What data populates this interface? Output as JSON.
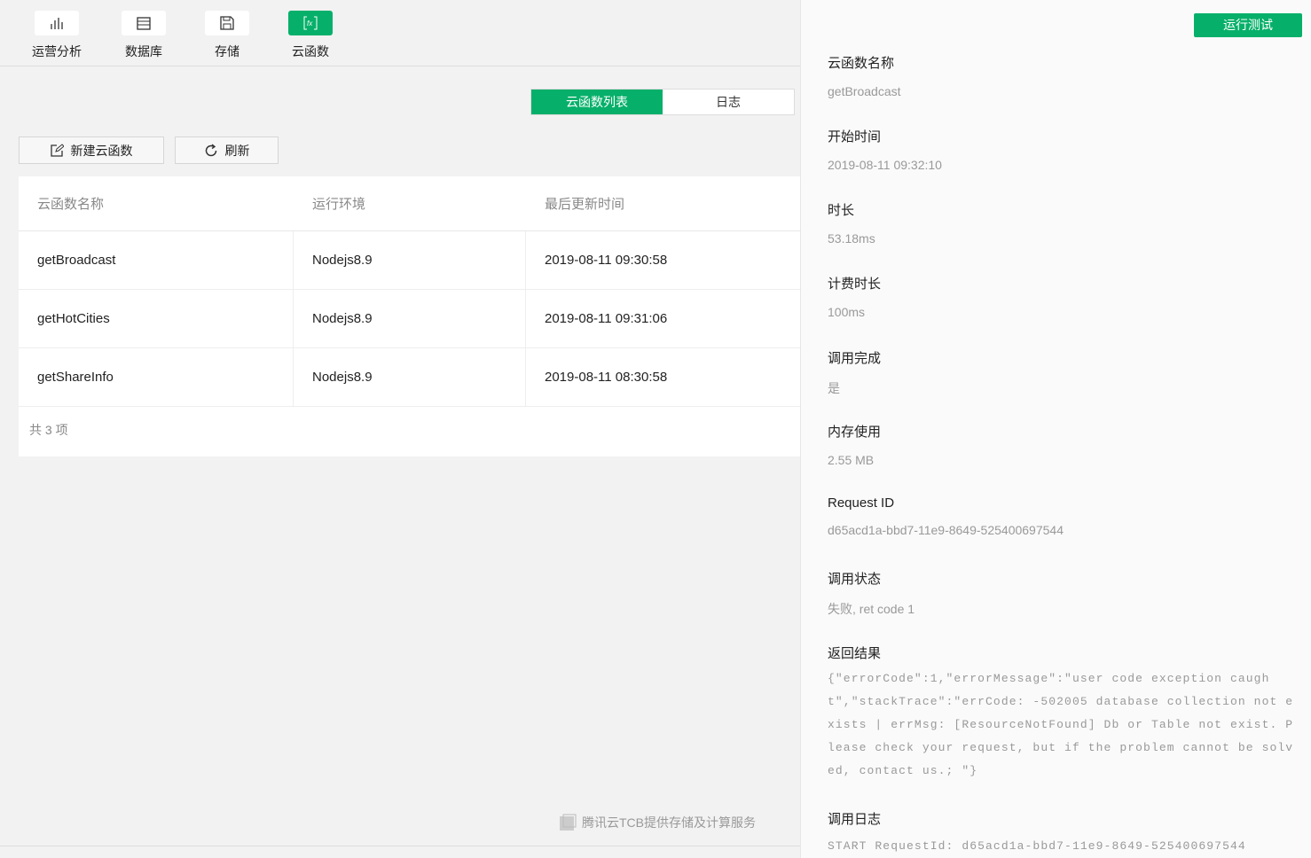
{
  "nav": [
    {
      "label": "运营分析",
      "icon": "bar-chart-icon"
    },
    {
      "label": "数据库",
      "icon": "database-icon"
    },
    {
      "label": "存储",
      "icon": "save-icon"
    },
    {
      "label": "云函数",
      "icon": "function-icon"
    }
  ],
  "tabs": [
    "云函数列表",
    "日志"
  ],
  "toolbar": {
    "new": "新建云函数",
    "refresh": "刷新"
  },
  "table": {
    "headers": [
      "云函数名称",
      "运行环境",
      "最后更新时间"
    ],
    "rows": [
      [
        "getBroadcast",
        "Nodejs8.9",
        "2019-08-11 09:30:58"
      ],
      [
        "getHotCities",
        "Nodejs8.9",
        "2019-08-11 09:31:06"
      ],
      [
        "getShareInfo",
        "Nodejs8.9",
        "2019-08-11 08:30:58"
      ]
    ],
    "total": "共 3 项"
  },
  "footer": "腾讯云TCB提供存储及计算服务",
  "panel": {
    "run_button": "运行测试",
    "fields": [
      {
        "label": "云函数名称",
        "value": "getBroadcast"
      },
      {
        "label": "开始时间",
        "value": "2019-08-11 09:32:10"
      },
      {
        "label": "时长",
        "value": "53.18ms"
      },
      {
        "label": "计费时长",
        "value": "100ms"
      },
      {
        "label": "调用完成",
        "value": "是"
      },
      {
        "label": "内存使用",
        "value": "2.55 MB"
      },
      {
        "label": "Request ID",
        "value": "d65acd1a-bbd7-11e9-8649-525400697544"
      },
      {
        "label": "调用状态",
        "value": "失败, ret code 1"
      }
    ],
    "result_label": "返回结果",
    "result": "{\"errorCode\":1,\"errorMessage\":\"user code exception caught\",\"stackTrace\":\"errCode: -502005 database collection not exists | errMsg: [ResourceNotFound] Db or Table not exist. Please check your request, but if the problem cannot be solved, contact us.; \"}",
    "log_label": "调用日志",
    "log": "START RequestId: d65acd1a-bbd7-11e9-8649-525400697544"
  }
}
